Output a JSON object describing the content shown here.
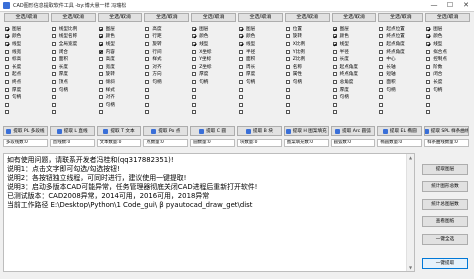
{
  "window": {
    "title": "CAD图形信息提取软件工具 -by:博大悬一样 冯瑞松",
    "minimize": "—",
    "maximize": "☐",
    "close": "✕"
  },
  "groups": [
    {
      "button": "全选/取消",
      "items": [
        {
          "label": "图层",
          "checked": true
        },
        {
          "label": "颜色",
          "checked": true
        },
        {
          "label": "线型",
          "checked": true
        },
        {
          "label": "线宽",
          "checked": false
        },
        {
          "label": "标高",
          "checked": false
        },
        {
          "label": "长度",
          "checked": false
        },
        {
          "label": "起点",
          "checked": false
        },
        {
          "label": "终点",
          "checked": false
        },
        {
          "label": "厚度",
          "checked": false
        },
        {
          "label": "句柄",
          "checked": false
        },
        {
          "label": "",
          "checked": false
        },
        {
          "label": "",
          "checked": false
        }
      ]
    },
    {
      "button": "全选/取消",
      "items": [
        {
          "label": "线型比例",
          "checked": false
        },
        {
          "label": "线型名称",
          "checked": false
        },
        {
          "label": "全局宽度",
          "checked": false
        },
        {
          "label": "闭合",
          "checked": false
        },
        {
          "label": "面积",
          "checked": false
        },
        {
          "label": "长度",
          "checked": false
        },
        {
          "label": "厚度",
          "checked": false
        },
        {
          "label": "顶点",
          "checked": false
        },
        {
          "label": "句柄",
          "checked": false
        },
        {
          "label": "",
          "checked": false
        },
        {
          "label": "",
          "checked": false
        },
        {
          "label": "",
          "checked": false
        }
      ]
    },
    {
      "button": "全选/取消",
      "items": [
        {
          "label": "图层",
          "checked": true
        },
        {
          "label": "颜色",
          "checked": true
        },
        {
          "label": "线型",
          "checked": true
        },
        {
          "label": "内容",
          "checked": true
        },
        {
          "label": "高度",
          "checked": false
        },
        {
          "label": "宽度",
          "checked": false
        },
        {
          "label": "旋转",
          "checked": false
        },
        {
          "label": "倾斜",
          "checked": false
        },
        {
          "label": "样式",
          "checked": false
        },
        {
          "label": "对齐",
          "checked": false
        },
        {
          "label": "句柄",
          "checked": false
        },
        {
          "label": "",
          "checked": false
        }
      ]
    },
    {
      "button": "全选/取消",
      "items": [
        {
          "label": "高度",
          "checked": false
        },
        {
          "label": "行距",
          "checked": false
        },
        {
          "label": "旋转",
          "checked": false
        },
        {
          "label": "行间",
          "checked": false
        },
        {
          "label": "样式",
          "checked": false
        },
        {
          "label": "对齐",
          "checked": false
        },
        {
          "label": "方向",
          "checked": false
        },
        {
          "label": "句柄",
          "checked": false
        },
        {
          "label": "",
          "checked": false
        },
        {
          "label": "",
          "checked": false
        },
        {
          "label": "",
          "checked": false
        },
        {
          "label": "",
          "checked": false
        }
      ]
    },
    {
      "button": "全选/取消",
      "items": [
        {
          "label": "图层",
          "checked": true
        },
        {
          "label": "颜色",
          "checked": true
        },
        {
          "label": "线型",
          "checked": true
        },
        {
          "label": "X坐标",
          "checked": false
        },
        {
          "label": "Y坐标",
          "checked": false
        },
        {
          "label": "Z坐标",
          "checked": false
        },
        {
          "label": "厚度",
          "checked": false
        },
        {
          "label": "句柄",
          "checked": false
        },
        {
          "label": "",
          "checked": false
        },
        {
          "label": "",
          "checked": false
        },
        {
          "label": "",
          "checked": false
        },
        {
          "label": "",
          "checked": false
        }
      ]
    },
    {
      "button": "全选/取消",
      "items": [
        {
          "label": "图层",
          "checked": true
        },
        {
          "label": "颜色",
          "checked": true
        },
        {
          "label": "线型",
          "checked": true
        },
        {
          "label": "半径",
          "checked": false
        },
        {
          "label": "面积",
          "checked": false
        },
        {
          "label": "周长",
          "checked": false
        },
        {
          "label": "厚度",
          "checked": false
        },
        {
          "label": "句柄",
          "checked": false
        },
        {
          "label": "",
          "checked": false
        },
        {
          "label": "",
          "checked": false
        },
        {
          "label": "",
          "checked": false
        },
        {
          "label": "",
          "checked": false
        }
      ]
    },
    {
      "button": "全选/取消",
      "items": [
        {
          "label": "位置",
          "checked": false
        },
        {
          "label": "旋转",
          "checked": false
        },
        {
          "label": "X比例",
          "checked": false
        },
        {
          "label": "Y比例",
          "checked": false
        },
        {
          "label": "Z比例",
          "checked": false
        },
        {
          "label": "名称",
          "checked": false
        },
        {
          "label": "属性",
          "checked": false
        },
        {
          "label": "句柄",
          "checked": false
        },
        {
          "label": "",
          "checked": false
        },
        {
          "label": "",
          "checked": false
        },
        {
          "label": "",
          "checked": false
        },
        {
          "label": "",
          "checked": false
        }
      ]
    },
    {
      "button": "全选/取消",
      "items": [
        {
          "label": "图层",
          "checked": true
        },
        {
          "label": "颜色",
          "checked": true
        },
        {
          "label": "线型",
          "checked": true
        },
        {
          "label": "半径",
          "checked": false
        },
        {
          "label": "长度",
          "checked": false
        },
        {
          "label": "起点角度",
          "checked": false
        },
        {
          "label": "终点角度",
          "checked": false
        },
        {
          "label": "总角度",
          "checked": false
        },
        {
          "label": "厚度",
          "checked": false
        },
        {
          "label": "句柄",
          "checked": false
        },
        {
          "label": "",
          "checked": false
        },
        {
          "label": "",
          "checked": false
        }
      ]
    },
    {
      "button": "全选/取消",
      "items": [
        {
          "label": "起点位置",
          "checked": false
        },
        {
          "label": "终点位置",
          "checked": false
        },
        {
          "label": "起点角度",
          "checked": false
        },
        {
          "label": "终点角度",
          "checked": false
        },
        {
          "label": "中心",
          "checked": false
        },
        {
          "label": "长轴",
          "checked": false
        },
        {
          "label": "短轴",
          "checked": false
        },
        {
          "label": "面积",
          "checked": false
        },
        {
          "label": "句柄",
          "checked": false
        },
        {
          "label": "",
          "checked": false
        },
        {
          "label": "",
          "checked": false
        },
        {
          "label": "",
          "checked": false
        }
      ]
    },
    {
      "button": "全选/取消",
      "items": [
        {
          "label": "图层",
          "checked": true
        },
        {
          "label": "颜色",
          "checked": true
        },
        {
          "label": "线型",
          "checked": true
        },
        {
          "label": "拟合点",
          "checked": false
        },
        {
          "label": "控制点",
          "checked": false
        },
        {
          "label": "阶数",
          "checked": false
        },
        {
          "label": "闭合",
          "checked": false
        },
        {
          "label": "长度",
          "checked": false
        },
        {
          "label": "句柄",
          "checked": false
        },
        {
          "label": "",
          "checked": false
        },
        {
          "label": "",
          "checked": false
        },
        {
          "label": "",
          "checked": false
        }
      ]
    }
  ],
  "extract_buttons": [
    {
      "label": "提取 PL 多段线",
      "color": "#3a6fd8"
    },
    {
      "label": "提取 L 直线",
      "color": "#3a6fd8"
    },
    {
      "label": "提取 T 文本",
      "color": "#3a6fd8"
    },
    {
      "label": "提取 Po 点",
      "color": "#3a6fd8"
    },
    {
      "label": "提取 C 圆",
      "color": "#3a6fd8"
    },
    {
      "label": "提取 B 块",
      "color": "#3a6fd8"
    },
    {
      "label": "提取 H 图案填充",
      "color": "#3a6fd8"
    },
    {
      "label": "提取 Arc 圆弧",
      "color": "#3a6fd8"
    },
    {
      "label": "提取 EL 椭圆",
      "color": "#3a6fd8"
    },
    {
      "label": "提取 SPL 样条曲线",
      "color": "#3a6fd8"
    }
  ],
  "counts": [
    "多段线数:0",
    "直线数:0",
    "文本数量:0",
    "点数量:0",
    "圆数量:0",
    "块数量:0",
    "图案填充数:0",
    "圆弧数:0",
    "椭圆数量:0",
    "样条曲线数量:0"
  ],
  "log_lines": [
    "如有使用问题，请联系开发者冯桂和(qq317882351)!",
    "说明1：点击文字即可勾选/勾选按钮!",
    "说明2：各按钮独立线程，可同时进行，建议使用一键提取!",
    "说明3：启动多版本CAD可能异常，任务管理器彻底关闭CAD进程后重新打开软件!",
    "已测试版本：CAD2008异常，2014可用，2016可用，2018异常",
    "当前工作路径 E:\\Desktop\\Python\\1 Code_gui\\ β pyautocad_draw_get\\dist"
  ],
  "side_buttons": [
    {
      "label": "提取图层",
      "primary": false
    },
    {
      "label": "统计图形总数",
      "primary": false
    },
    {
      "label": "统计总图层数",
      "primary": false
    },
    {
      "label": "查看图纸",
      "primary": false
    },
    {
      "label": "一键全选",
      "primary": false
    },
    {
      "label": "一键提取",
      "primary": true
    }
  ]
}
